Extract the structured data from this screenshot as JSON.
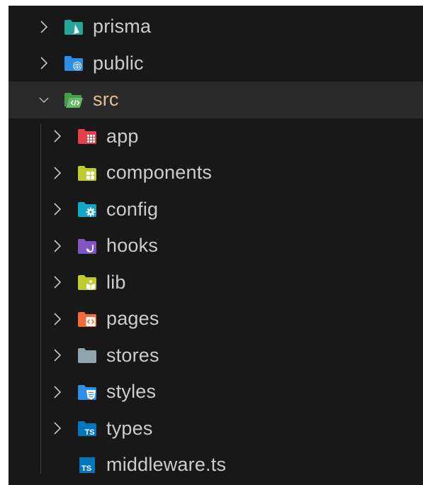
{
  "explorer": {
    "items": [
      {
        "label": "prisma",
        "depth": 0,
        "state": "collapsed",
        "icon": "prisma-folder-icon",
        "color": "#26b5a0"
      },
      {
        "label": "public",
        "depth": 0,
        "state": "collapsed",
        "icon": "public-folder-icon",
        "color": "#2e8de6"
      },
      {
        "label": "src",
        "depth": 0,
        "state": "expanded",
        "icon": "src-folder-icon",
        "color": "#4caf50"
      },
      {
        "label": "app",
        "depth": 1,
        "state": "collapsed",
        "icon": "app-folder-icon",
        "color": "#e5414c"
      },
      {
        "label": "components",
        "depth": 1,
        "state": "collapsed",
        "icon": "components-folder-icon",
        "color": "#c0ca33"
      },
      {
        "label": "config",
        "depth": 1,
        "state": "collapsed",
        "icon": "config-folder-icon",
        "color": "#13a7c7"
      },
      {
        "label": "hooks",
        "depth": 1,
        "state": "collapsed",
        "icon": "hooks-folder-icon",
        "color": "#7e57c2"
      },
      {
        "label": "lib",
        "depth": 1,
        "state": "collapsed",
        "icon": "lib-folder-icon",
        "color": "#c0ca33"
      },
      {
        "label": "pages",
        "depth": 1,
        "state": "collapsed",
        "icon": "pages-folder-icon",
        "color": "#f4683a"
      },
      {
        "label": "stores",
        "depth": 1,
        "state": "collapsed",
        "icon": "folder-icon",
        "color": "#90a4ae"
      },
      {
        "label": "styles",
        "depth": 1,
        "state": "collapsed",
        "icon": "styles-folder-icon",
        "color": "#2e8de6"
      },
      {
        "label": "types",
        "depth": 1,
        "state": "collapsed",
        "icon": "types-folder-icon",
        "color": "#0277bd"
      },
      {
        "label": "middleware.ts",
        "depth": 1,
        "state": "file",
        "icon": "typescript-file-icon",
        "color": "#0277bd"
      }
    ],
    "icon_text": {
      "ts": "TS",
      "code": "<>"
    }
  }
}
